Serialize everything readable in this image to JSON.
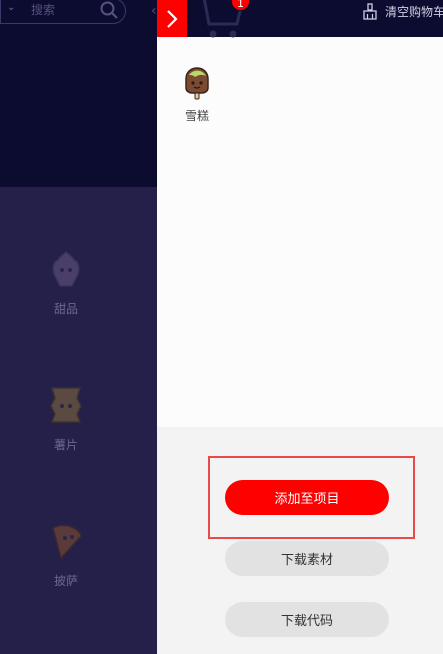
{
  "background": {
    "search_placeholder": "搜索",
    "categories": [
      {
        "label": "甜品",
        "icon": "sweets-icon"
      },
      {
        "label": "薯片",
        "icon": "chips-icon"
      },
      {
        "label": "披萨",
        "icon": "pizza-icon"
      }
    ]
  },
  "drawer": {
    "cart_count": "1",
    "clear_cart_label": "清空购物车",
    "items": [
      {
        "label": "雪糕",
        "icon": "ice-cream-icon"
      }
    ],
    "buttons": {
      "add_to_project": "添加至项目",
      "download_assets": "下载素材",
      "download_code": "下载代码"
    }
  },
  "colors": {
    "accent": "#ff0000",
    "header_bg": "#0c0b30",
    "overlay_bg": "#242049",
    "highlight": "#e84a4a"
  }
}
